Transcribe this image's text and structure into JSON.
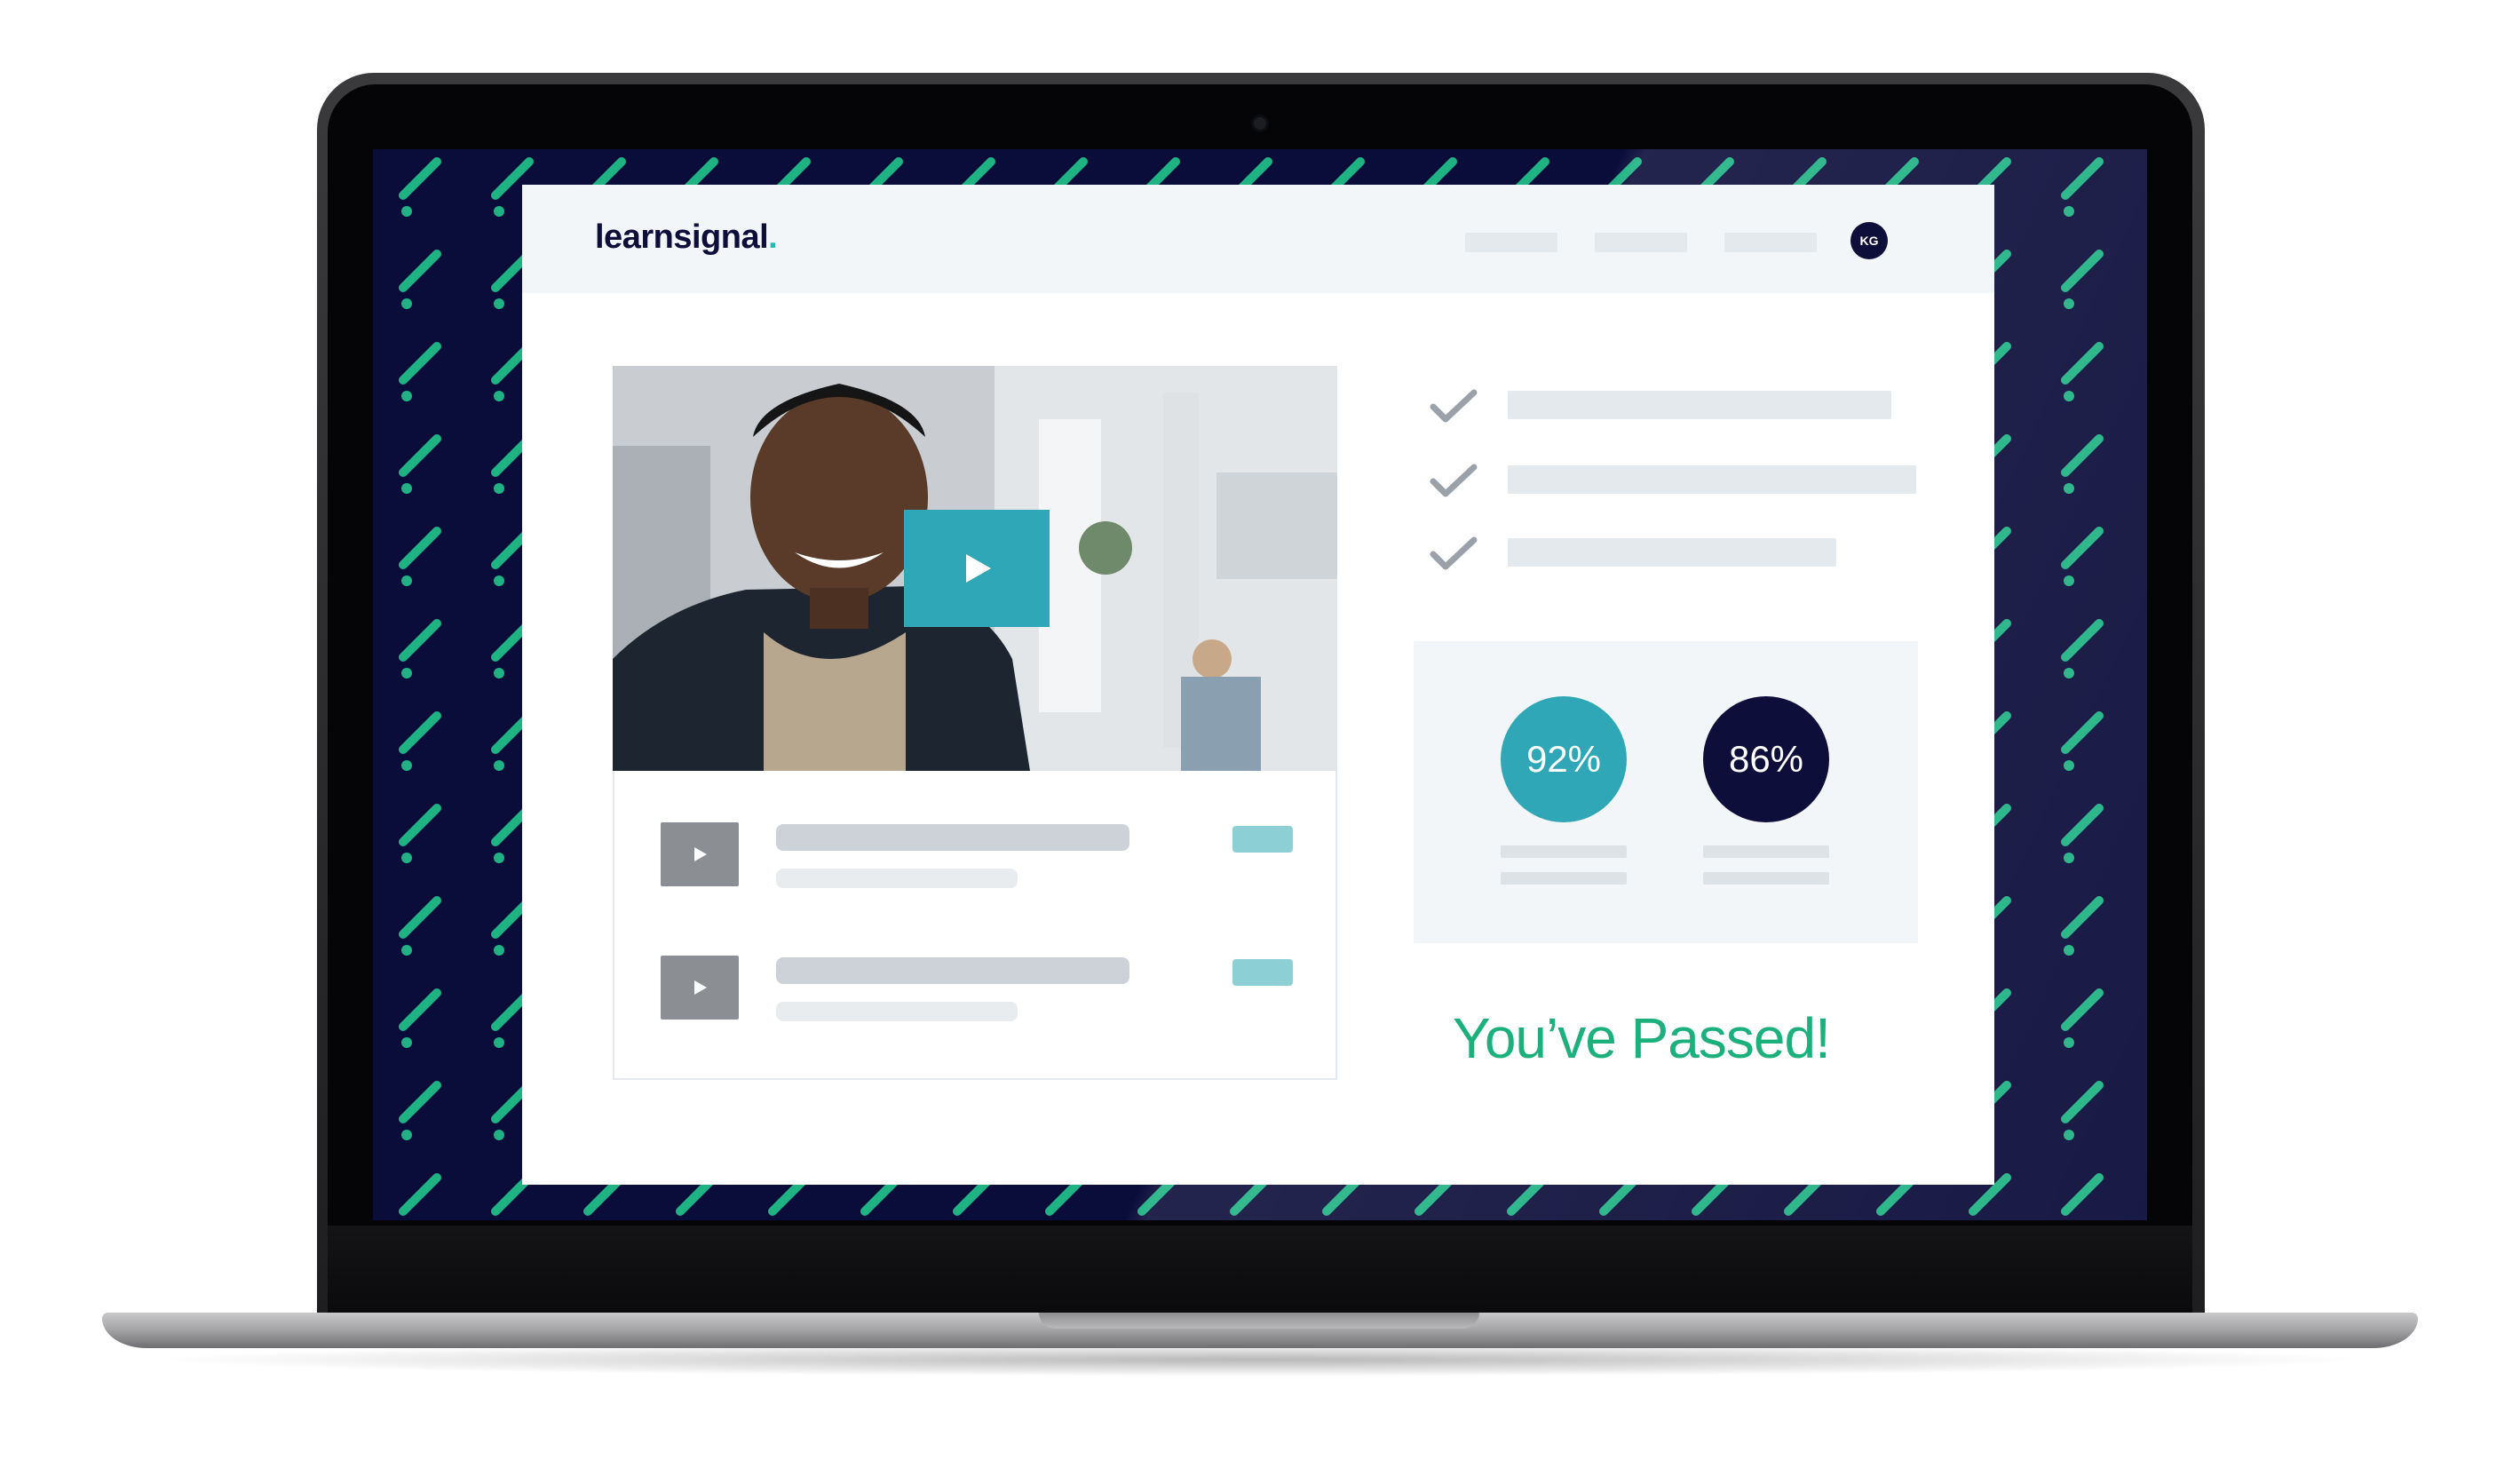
{
  "brand": {
    "name": "learnsignal",
    "dot": ".",
    "accent": "#2bb6b9",
    "navy": "#0d0f3a",
    "green": "#1cb07c"
  },
  "header": {
    "avatar_initials": "KG",
    "nav_items": [
      "",
      "",
      ""
    ]
  },
  "video": {
    "play_icon": "play-icon"
  },
  "lessons": [
    {
      "icon": "play-icon"
    },
    {
      "icon": "play-icon"
    }
  ],
  "checklist": [
    {
      "icon": "check-icon"
    },
    {
      "icon": "check-icon"
    },
    {
      "icon": "check-icon"
    }
  ],
  "scores": [
    {
      "value": "92%",
      "color": "#2fa7b6"
    },
    {
      "value": "86%",
      "color": "#0d0f3a"
    }
  ],
  "result": {
    "message": "You’ve Passed!"
  }
}
